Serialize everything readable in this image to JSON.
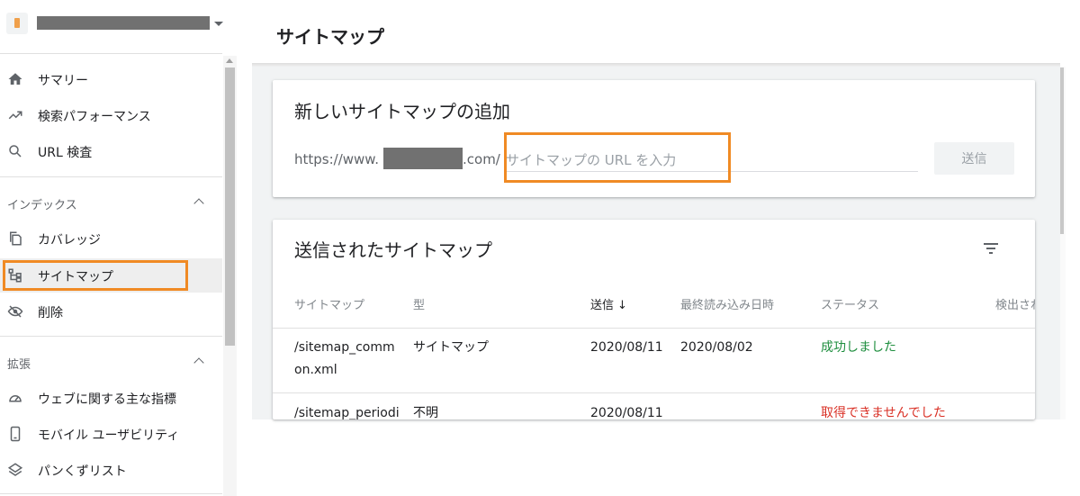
{
  "page": {
    "title": "サイトマップ"
  },
  "sidebar": {
    "items": [
      {
        "id": "summary",
        "label": "サマリー",
        "icon": "home-icon"
      },
      {
        "id": "performance",
        "label": "検索パフォーマンス",
        "icon": "trending-up-icon"
      },
      {
        "id": "url-inspection",
        "label": "URL 検査",
        "icon": "search-icon"
      }
    ],
    "sections": [
      {
        "label": "インデックス",
        "items": [
          {
            "id": "coverage",
            "label": "カバレッジ",
            "icon": "copy-icon"
          },
          {
            "id": "sitemaps",
            "label": "サイトマップ",
            "icon": "sitemap-icon",
            "active": true
          },
          {
            "id": "removals",
            "label": "削除",
            "icon": "eye-off-icon"
          }
        ]
      },
      {
        "label": "拡張",
        "items": [
          {
            "id": "web-vitals",
            "label": "ウェブに関する主な指標",
            "icon": "gauge-icon"
          },
          {
            "id": "mobile",
            "label": "モバイル ユーザビリティ",
            "icon": "smartphone-icon"
          },
          {
            "id": "breadcrumbs",
            "label": "パンくずリスト",
            "icon": "layers-icon"
          }
        ]
      }
    ]
  },
  "add_card": {
    "title": "新しいサイトマップの追加",
    "url_prefix_start": "https://www.",
    "url_prefix_end": ".com/",
    "input_placeholder": "サイトマップの URL を入力",
    "input_value": "",
    "submit_label": "送信"
  },
  "list_card": {
    "title": "送信されたサイトマップ",
    "columns": [
      "サイトマップ",
      "型",
      "送信",
      "最終読み込み日時",
      "ステータス",
      "検出され"
    ],
    "sort_arrow": "↓",
    "rows": [
      {
        "sitemap": "/sitemap_comm",
        "sitemap_cont": "on.xml",
        "type": "サイトマップ",
        "submitted": "2020/08/11",
        "last_read": "2020/08/02",
        "status": "成功しました",
        "status_kind": "success"
      },
      {
        "sitemap": "/sitemap_periodi",
        "sitemap_cont": "",
        "type": "不明",
        "submitted": "2020/08/11",
        "last_read": "",
        "status": "取得できませんでした",
        "status_kind": "error"
      }
    ]
  },
  "colors": {
    "highlight": "#f08a24",
    "success": "#1e8e3e",
    "error": "#d93025"
  }
}
